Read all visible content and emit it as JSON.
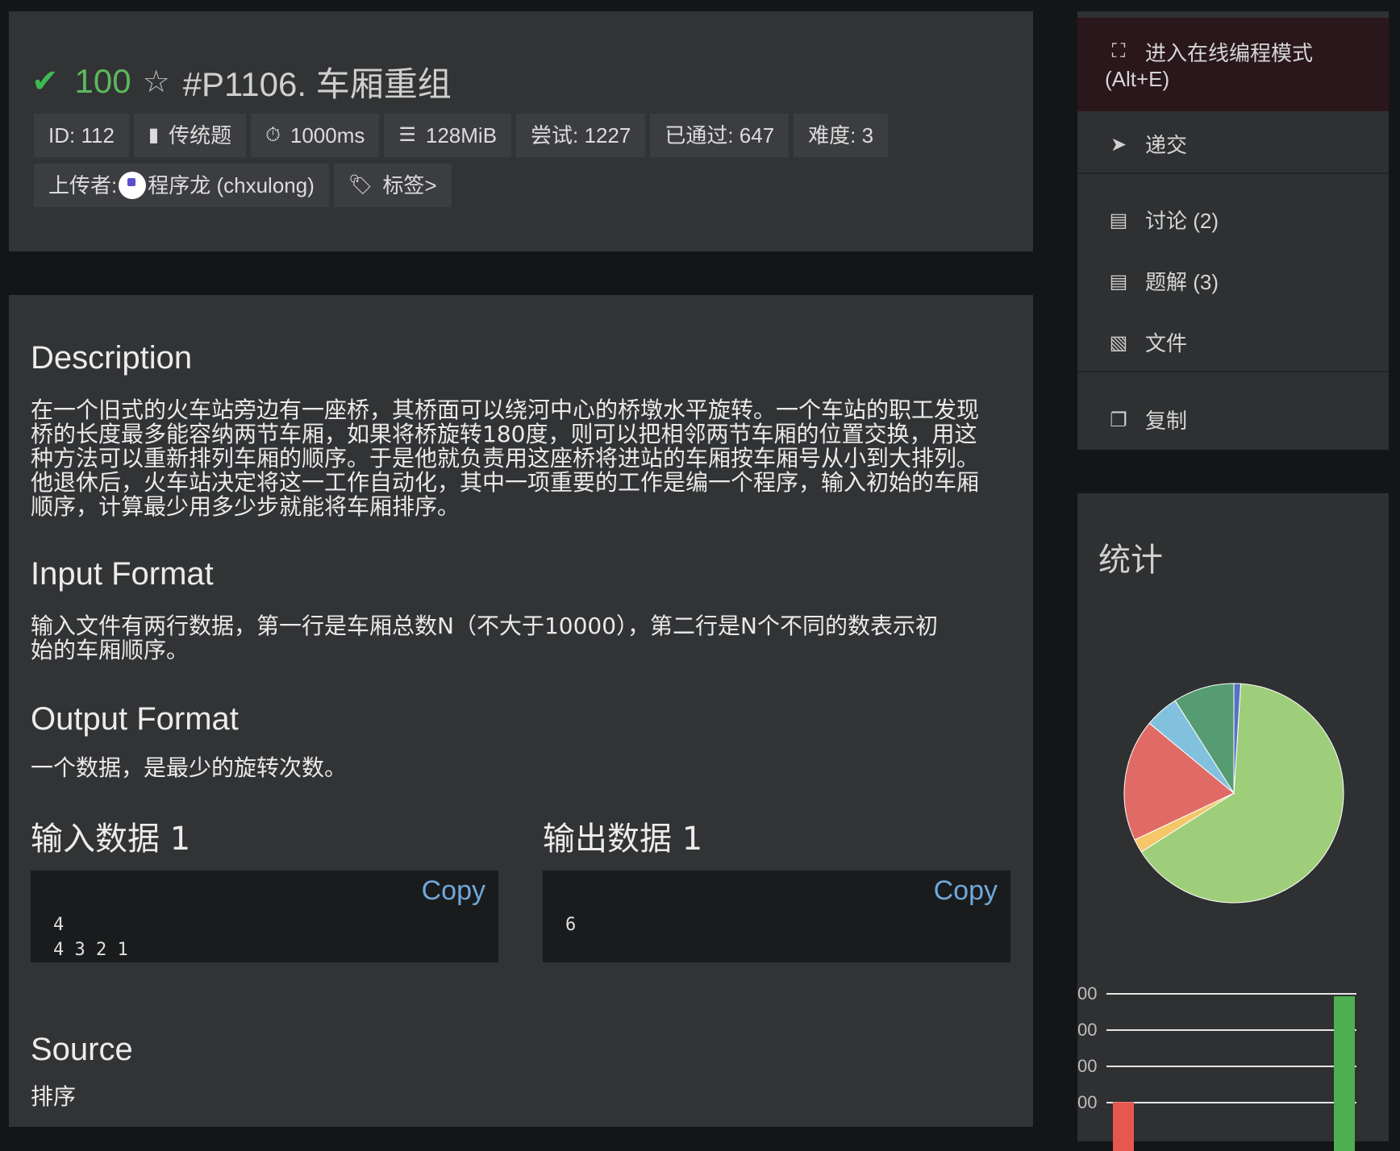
{
  "problem": {
    "score": "100",
    "title": "#P1106. 车厢重组",
    "meta_row1": [
      {
        "icon": "id",
        "label": "ID: 112"
      },
      {
        "icon": "book-icon",
        "label": "传统题"
      },
      {
        "icon": "stopwatch-icon",
        "label": "1000ms"
      },
      {
        "icon": "memory-icon",
        "label": "128MiB"
      },
      {
        "icon": "",
        "label": "尝试: 1227"
      },
      {
        "icon": "",
        "label": "已通过: 647"
      },
      {
        "icon": "",
        "label": "难度: 3"
      }
    ],
    "uploader_label": "上传者:",
    "uploader_name": "程序龙 (chxulong)",
    "tags_label": "标签>"
  },
  "content": {
    "description_h": "Description",
    "description_lines": [
      "在一个旧式的火车站旁边有一座桥，其桥面可以绕河中心的桥墩水平旋转。一个车站的职工发现",
      "桥的长度最多能容纳两节车厢，如果将桥旋转180度，则可以把相邻两节车厢的位置交换，用这",
      "种方法可以重新排列车厢的顺序。于是他就负责用这座桥将进站的车厢按车厢号从小到大排列。",
      "他退休后，火车站决定将这一工作自动化，其中一项重要的工作是编一个程序，输入初始的车厢",
      "顺序，计算最少用多少步就能将车厢排序。"
    ],
    "input_h": "Input Format",
    "input_lines": [
      "输入文件有两行数据，第一行是车厢总数N（不大于10000），第二行是N个不同的数表示初",
      "始的车厢顺序。"
    ],
    "output_h": "Output Format",
    "output_text": "一个数据，是最少的旋转次数。",
    "sample_in_h": "输入数据 1",
    "sample_out_h": "输出数据 1",
    "copy_label": "Copy",
    "sample_in": "4\n4 3 2 1",
    "sample_out": "6",
    "source_h": "Source",
    "source_text": "排序"
  },
  "sidebar": {
    "online_mode": "进入在线编程模式",
    "online_mode_hotkey": "(Alt+E)",
    "submit": "递交",
    "discuss": "讨论 (2)",
    "solutions": "题解 (3)",
    "files": "文件",
    "copy": "复制"
  },
  "stats": {
    "title": "统计",
    "y_tick_fragment": "00"
  },
  "chart_data": [
    {
      "type": "pie",
      "title": "",
      "series": [
        {
          "name": "",
          "value": 65,
          "color": "#9fce7b"
        },
        {
          "name": "",
          "value": 2,
          "color": "#f5c769"
        },
        {
          "name": "",
          "value": 18,
          "color": "#e06b66"
        },
        {
          "name": "",
          "value": 5,
          "color": "#82c1de"
        },
        {
          "name": "",
          "value": 9,
          "color": "#569c72"
        },
        {
          "name": "",
          "value": 1,
          "color": "#5871c4"
        }
      ]
    },
    {
      "type": "bar",
      "title": "",
      "note": "partially cropped; only the two visible bars",
      "values": [
        0.35,
        0.02,
        1.0
      ],
      "colors": [
        "#e8574f",
        "#e8574f",
        "#4caf50"
      ]
    }
  ]
}
